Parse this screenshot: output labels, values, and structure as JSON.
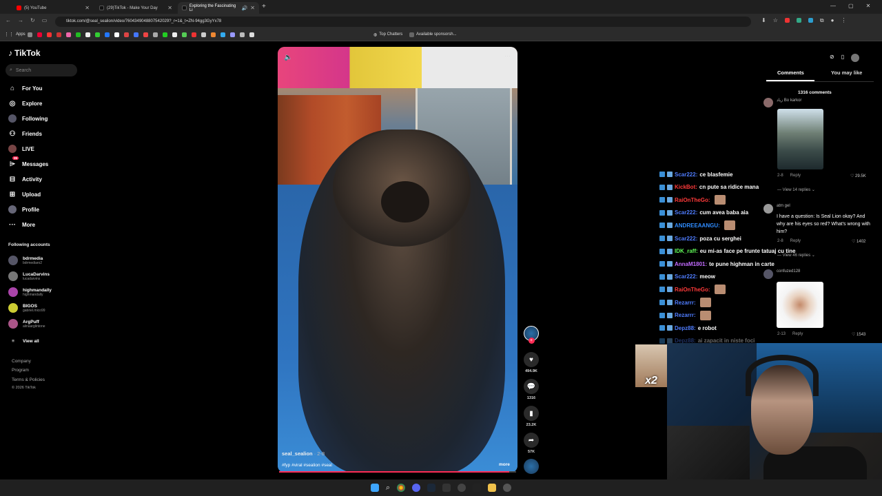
{
  "browser": {
    "tabs": [
      {
        "title": "(5) YouTube",
        "color": "#ff0000"
      },
      {
        "title": "(29)TikTok - Make Your Day",
        "color": "#111111"
      },
      {
        "title": "Exploring the Fascinating Li",
        "color": "#111111"
      }
    ],
    "url": "tiktok.com/@seal_sealion/video/7604349048807542029?_r=1&_t=ZN-94gg3GyYx78",
    "bookmarks": {
      "apps": "Apps",
      "top_chatters": "Top Chatters",
      "available": "Available sponsorsh..."
    }
  },
  "sidebar": {
    "logo": "TikTok",
    "search_placeholder": "Search",
    "nav": [
      {
        "label": "For You",
        "icon": "home-icon"
      },
      {
        "label": "Explore",
        "icon": "compass-icon"
      },
      {
        "label": "Following",
        "icon": "following-icon"
      },
      {
        "label": "Friends",
        "icon": "friends-icon"
      },
      {
        "label": "LIVE",
        "icon": "live-icon"
      },
      {
        "label": "Messages",
        "icon": "messages-icon",
        "badge": "35"
      },
      {
        "label": "Activity",
        "icon": "activity-icon"
      },
      {
        "label": "Upload",
        "icon": "upload-icon"
      },
      {
        "label": "Profile",
        "icon": "profile-icon"
      },
      {
        "label": "More",
        "icon": "more-icon"
      }
    ],
    "following_title": "Following accounts",
    "accounts": [
      {
        "name": "bdrmedia",
        "handle": "bdrmediaro2"
      },
      {
        "name": "LucaDarvins",
        "handle": "lucadarvins"
      },
      {
        "name": "highmandally",
        "handle": "highmandally"
      },
      {
        "name": "BIGOS",
        "handle": "gabriel.mico99"
      },
      {
        "name": "ArgPuff",
        "handle": "alinaarglintone"
      }
    ],
    "view_all": "View all",
    "footer": {
      "company": "Company",
      "program": "Program",
      "terms": "Terms & Policies",
      "copyright": "© 2026 TikTok"
    }
  },
  "video": {
    "author": "seal_sealion",
    "date": " · 2-8",
    "tags": "#fyp #viral #sealion #seal",
    "more": "more",
    "progress": 0.97
  },
  "actions": {
    "likes": "494.9K",
    "comments": "1316",
    "saves": "23.2K",
    "shares": "57K"
  },
  "panel": {
    "tabs": {
      "comments": "Comments",
      "you_may_like": "You may like"
    },
    "comment_count": "1316 comments",
    "comments": [
      {
        "name": "زياد Bo karkor",
        "date": "2-8",
        "reply": "Reply",
        "likes": "29.5K",
        "replies": "View 14 replies"
      },
      {
        "name": "atm gel",
        "text": "I have a question: Is Seal Lion okay? And why are his eyes so red? What's wrong with him?",
        "date": "2-8",
        "reply": "Reply",
        "likes": "1402",
        "replies": "View 46 replies"
      },
      {
        "name": "confuzed128",
        "date": "2-13",
        "reply": "Reply",
        "likes": "1543"
      }
    ]
  },
  "chat": [
    {
      "user": "Scar222:",
      "msg": "ce blasfemie",
      "color": "#4f7dff"
    },
    {
      "user": "KickBot:",
      "msg": "cn pute sa ridice mana",
      "color": "#ff3a3a"
    },
    {
      "user": "RaiOnTheGo:",
      "msg": "",
      "color": "#ff3a3a"
    },
    {
      "user": "Scar222:",
      "msg": "cum avea baba aia",
      "color": "#4f7dff"
    },
    {
      "user": "ANDREEAANGU:",
      "msg": "",
      "color": "#2f8cff"
    },
    {
      "user": "Scar222:",
      "msg": "poza cu serghei",
      "color": "#4f7dff"
    },
    {
      "user": "IDK_raff:",
      "msg": "eu mi-as face pe frunte tatuaj cu tine",
      "color": "#63ff5a"
    },
    {
      "user": "AnnaM1801:",
      "msg": "te pune highman in carte",
      "color": "#c26bff"
    },
    {
      "user": "Scar222:",
      "msg": "meow",
      "color": "#4f7dff"
    },
    {
      "user": "RaiOnTheGo:",
      "msg": "",
      "color": "#ff3a3a"
    },
    {
      "user": "Rezarrr:",
      "msg": "",
      "color": "#4f7dff"
    },
    {
      "user": "Rezarrr:",
      "msg": "",
      "color": "#4f7dff"
    },
    {
      "user": "Depz88:",
      "msg": "e robot",
      "color": "#4f7dff"
    },
    {
      "user": "Depz88:",
      "msg": "ai zapacit in niste foci",
      "color": "#4f7dff"
    }
  ],
  "overlay": {
    "emote_text": "x2"
  }
}
